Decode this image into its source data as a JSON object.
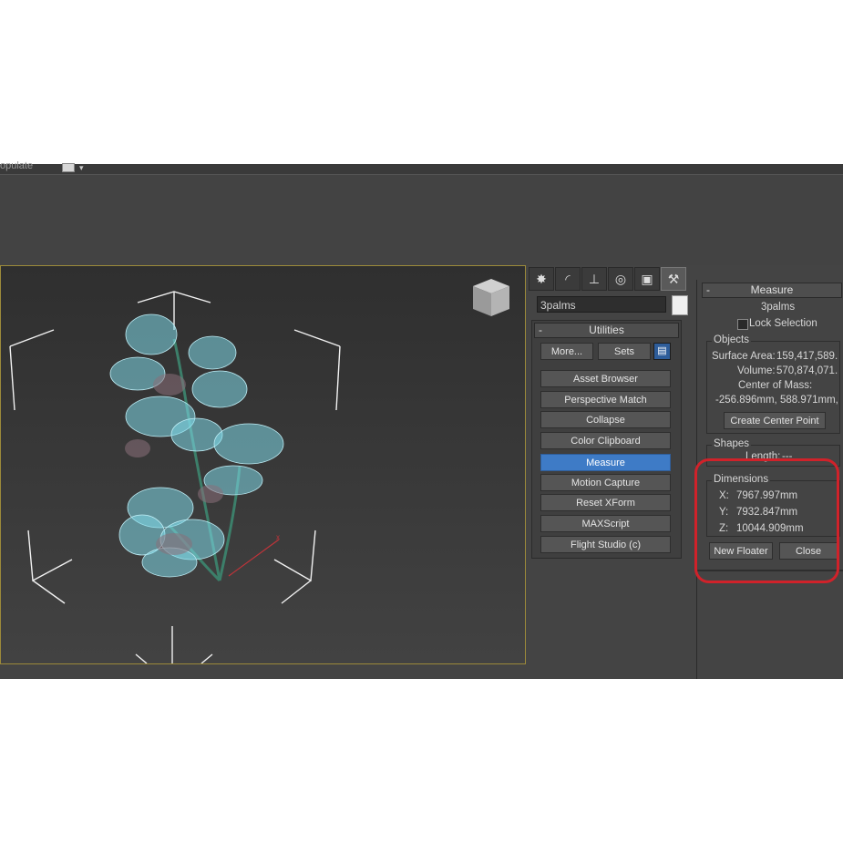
{
  "toolbar": {
    "partial_label": "opulate"
  },
  "command_panel": {
    "tabs": [
      {
        "name": "create",
        "glyph": "✸"
      },
      {
        "name": "modify",
        "glyph": "◜"
      },
      {
        "name": "hierarchy",
        "glyph": "⊥"
      },
      {
        "name": "motion",
        "glyph": "◎"
      },
      {
        "name": "display",
        "glyph": "▣"
      },
      {
        "name": "utilities",
        "glyph": "⚒"
      }
    ],
    "object_name": "3palms",
    "object_color": "#f0f0f0",
    "utilities": {
      "title": "Utilities",
      "collapse_symbol": "-",
      "more_label": "More...",
      "sets_label": "Sets",
      "items": [
        "Asset Browser",
        "Perspective Match",
        "Collapse",
        "Color Clipboard",
        "Measure",
        "Motion Capture",
        "Reset XForm",
        "MAXScript",
        "Flight Studio (c)"
      ],
      "active_item": "Measure"
    }
  },
  "measure": {
    "title": "Measure",
    "collapse_symbol": "-",
    "object_name": "3palms",
    "lock_selection_label": "Lock Selection",
    "lock_selection_checked": false,
    "objects": {
      "group_label": "Objects",
      "surface_area_label": "Surface Area:",
      "surface_area_value": "159,417,589.",
      "volume_label": "Volume:",
      "volume_value": "570,874,071.",
      "center_of_mass_label": "Center of Mass:",
      "center_of_mass_value": "-256.896mm, 588.971mm,",
      "create_center_point_label": "Create Center Point"
    },
    "shapes": {
      "group_label": "Shapes",
      "length_label": "Length:",
      "length_value": "---"
    },
    "dimensions": {
      "group_label": "Dimensions",
      "x_label": "X:",
      "x_value": "7967.997mm",
      "y_label": "Y:",
      "y_value": "7932.847mm",
      "z_label": "Z:",
      "z_value": "10044.909mm"
    },
    "new_floater_label": "New Floater",
    "close_label": "Close"
  },
  "colors": {
    "active_button": "#3e7bc6",
    "viewport_border": "#9c8a3a",
    "highlight_outline": "#d0222a",
    "foliage": "#7fd8e8"
  }
}
